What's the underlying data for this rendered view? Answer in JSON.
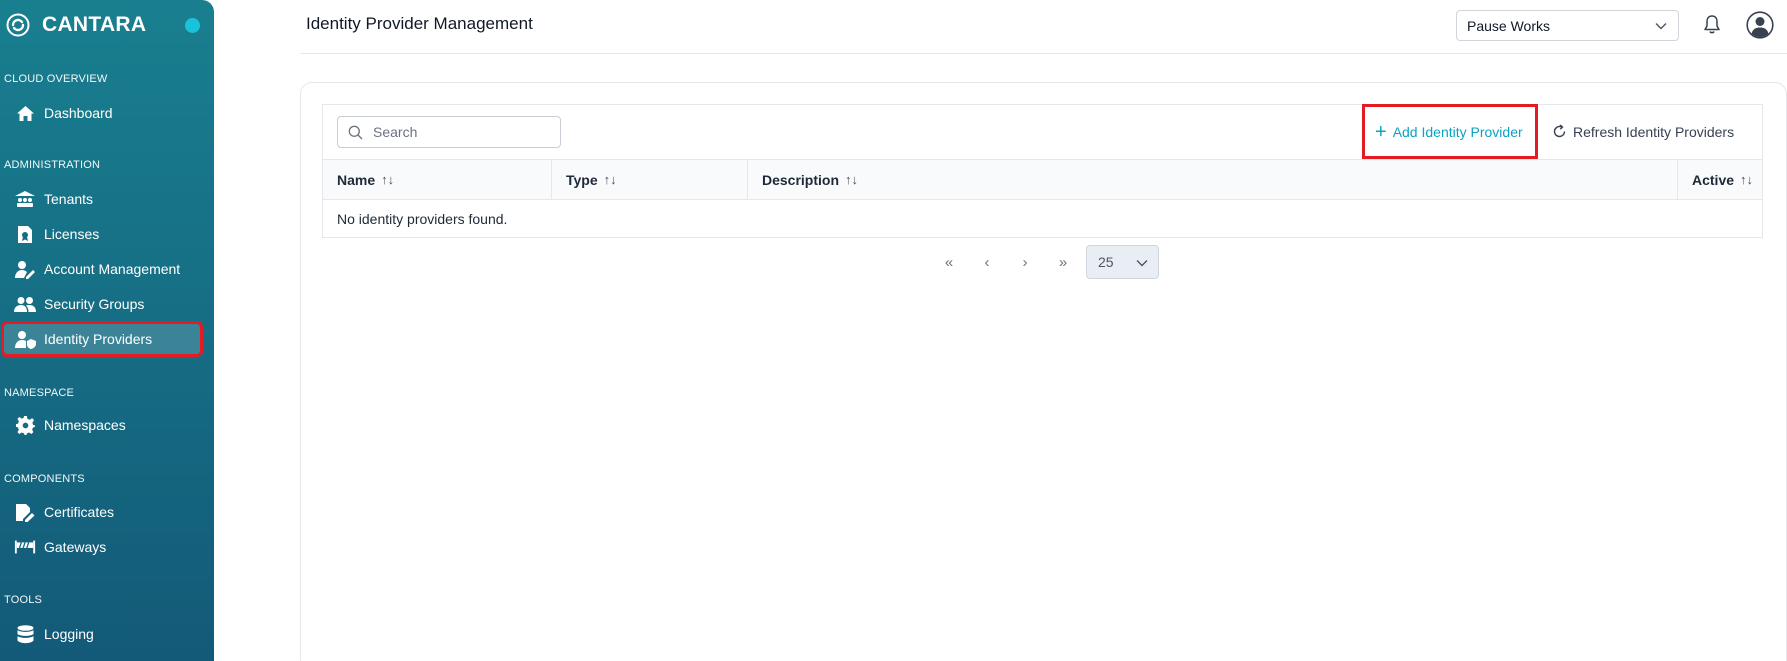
{
  "app": {
    "brand": "CANTARA"
  },
  "sidebar": {
    "sections": [
      {
        "title": "CLOUD OVERVIEW",
        "items": [
          {
            "label": "Dashboard",
            "icon": "home-icon"
          }
        ]
      },
      {
        "title": "ADMINISTRATION",
        "items": [
          {
            "label": "Tenants",
            "icon": "tenants-icon"
          },
          {
            "label": "Licenses",
            "icon": "license-icon"
          },
          {
            "label": "Account Management",
            "icon": "user-edit-icon"
          },
          {
            "label": "Security Groups",
            "icon": "users-group-icon"
          },
          {
            "label": "Identity Providers",
            "icon": "user-shield-icon",
            "active": true
          }
        ]
      },
      {
        "title": "NAMESPACE",
        "items": [
          {
            "label": "Namespaces",
            "icon": "gear-icon"
          }
        ]
      },
      {
        "title": "COMPONENTS",
        "items": [
          {
            "label": "Certificates",
            "icon": "certificate-icon"
          },
          {
            "label": "Gateways",
            "icon": "gateway-icon"
          }
        ]
      },
      {
        "title": "TOOLS",
        "items": [
          {
            "label": "Logging",
            "icon": "database-icon"
          }
        ]
      }
    ]
  },
  "header": {
    "title": "Identity Provider Management",
    "workspace": "Pause Works"
  },
  "toolbar": {
    "search_placeholder": "Search",
    "add_label": "Add Identity Provider",
    "refresh_label": "Refresh Identity Providers"
  },
  "table": {
    "columns": [
      "Name",
      "Type",
      "Description",
      "Active"
    ],
    "empty_message": "No identity providers found."
  },
  "pagination": {
    "first": "«",
    "prev": "‹",
    "next": "›",
    "last": "»",
    "page_size": "25"
  },
  "colors": {
    "accent": "#0aa3c2",
    "highlight": "#e31b23",
    "sidebar": "#166d84"
  }
}
